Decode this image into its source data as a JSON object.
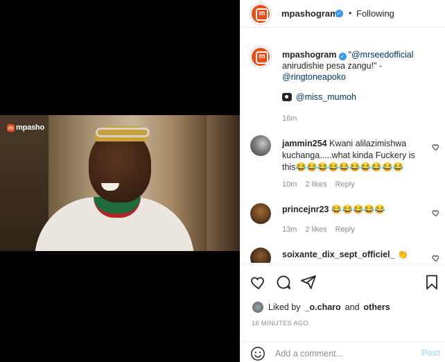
{
  "brand": {
    "logo_text": "mpasho",
    "logo_sub": ""
  },
  "header": {
    "username": "mpashogram",
    "separator": "•",
    "follow_status": "Following"
  },
  "caption": {
    "username": "mpashogram",
    "quote_open": "\"",
    "mention1": "@mrseedofficial",
    "text": "anirudishie pesa zangu!\" -",
    "mention2": "@ringtoneapoko",
    "credit_mention": "@miss_mumoh",
    "time": "16m"
  },
  "comments": [
    {
      "username": "jammin254",
      "text": "Kwani alilazimishwa kuchanga.....what kinda Fuckery is this😂😂😂😂😂😂😂😂😂😂",
      "time": "10m",
      "likes": "2 likes",
      "reply": "Reply"
    },
    {
      "username": "princejnr23",
      "text": "😂😂😂😂😂",
      "time": "13m",
      "likes": "2 likes",
      "reply": "Reply"
    },
    {
      "username": "soixante_dix_sept_officiel_",
      "text": "👏"
    }
  ],
  "likes": {
    "prefix": "Liked by",
    "user": "_o.charo",
    "and": "and",
    "others": "others"
  },
  "posted": "16 MINUTES AGO",
  "comment_box": {
    "placeholder": "Add a comment...",
    "post_label": "Post"
  },
  "colors": {
    "brand": "#e94e1b",
    "verified": "#3897f0",
    "link": "#003569",
    "muted": "#8e8e8e"
  }
}
